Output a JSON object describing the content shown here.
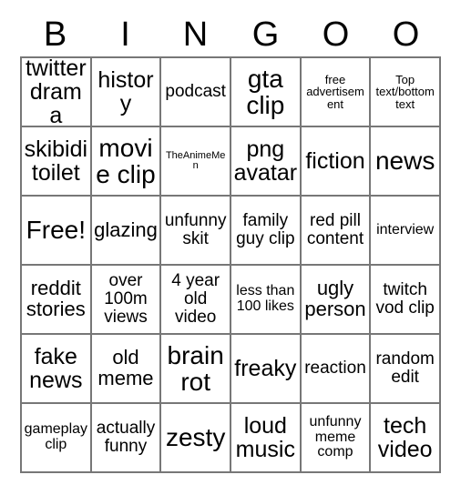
{
  "card": {
    "title": "Bingo Card",
    "header_letters": [
      "B",
      "I",
      "N",
      "G",
      "O",
      "O"
    ],
    "columns": 6,
    "rows": 6,
    "free_space_label": "Free!",
    "border_color": "#777777",
    "text_color": "#000000",
    "background_color": "#ffffff",
    "cells": [
      [
        {
          "text": "twitter drama",
          "size": "xl"
        },
        {
          "text": "history",
          "size": "xl"
        },
        {
          "text": "podcast",
          "size": "m"
        },
        {
          "text": "gta clip",
          "size": "xxl"
        },
        {
          "text": "free advertisement",
          "size": "xs"
        },
        {
          "text": "Top text/bottom text",
          "size": "xs"
        }
      ],
      [
        {
          "text": "skibidi toilet",
          "size": "xl"
        },
        {
          "text": "movie clip",
          "size": "xxl"
        },
        {
          "text": "TheAnimeMen",
          "size": "xxs"
        },
        {
          "text": "png avatar",
          "size": "xl"
        },
        {
          "text": "fiction",
          "size": "xl"
        },
        {
          "text": "news",
          "size": "xxl"
        }
      ],
      [
        {
          "text": "Free!",
          "size": "xxl"
        },
        {
          "text": "glazing",
          "size": "l"
        },
        {
          "text": "unfunny skit",
          "size": "m"
        },
        {
          "text": "family guy clip",
          "size": "m"
        },
        {
          "text": "red pill content",
          "size": "m"
        },
        {
          "text": "interview",
          "size": "s"
        }
      ],
      [
        {
          "text": "reddit stories",
          "size": "l"
        },
        {
          "text": "over 100m views",
          "size": "m"
        },
        {
          "text": "4 year old video",
          "size": "m"
        },
        {
          "text": "less than 100 likes",
          "size": "s"
        },
        {
          "text": "ugly person",
          "size": "l"
        },
        {
          "text": "twitch vod clip",
          "size": "m"
        }
      ],
      [
        {
          "text": "fake news",
          "size": "xl"
        },
        {
          "text": "old meme",
          "size": "l"
        },
        {
          "text": "brain rot",
          "size": "xxl"
        },
        {
          "text": "freaky",
          "size": "xl"
        },
        {
          "text": "reaction",
          "size": "m"
        },
        {
          "text": "random edit",
          "size": "m"
        }
      ],
      [
        {
          "text": "gameplay clip",
          "size": "s"
        },
        {
          "text": "actually funny",
          "size": "m"
        },
        {
          "text": "zesty",
          "size": "xxl"
        },
        {
          "text": "loud music",
          "size": "xl"
        },
        {
          "text": "unfunny meme comp",
          "size": "s"
        },
        {
          "text": "tech video",
          "size": "xl"
        }
      ]
    ]
  }
}
